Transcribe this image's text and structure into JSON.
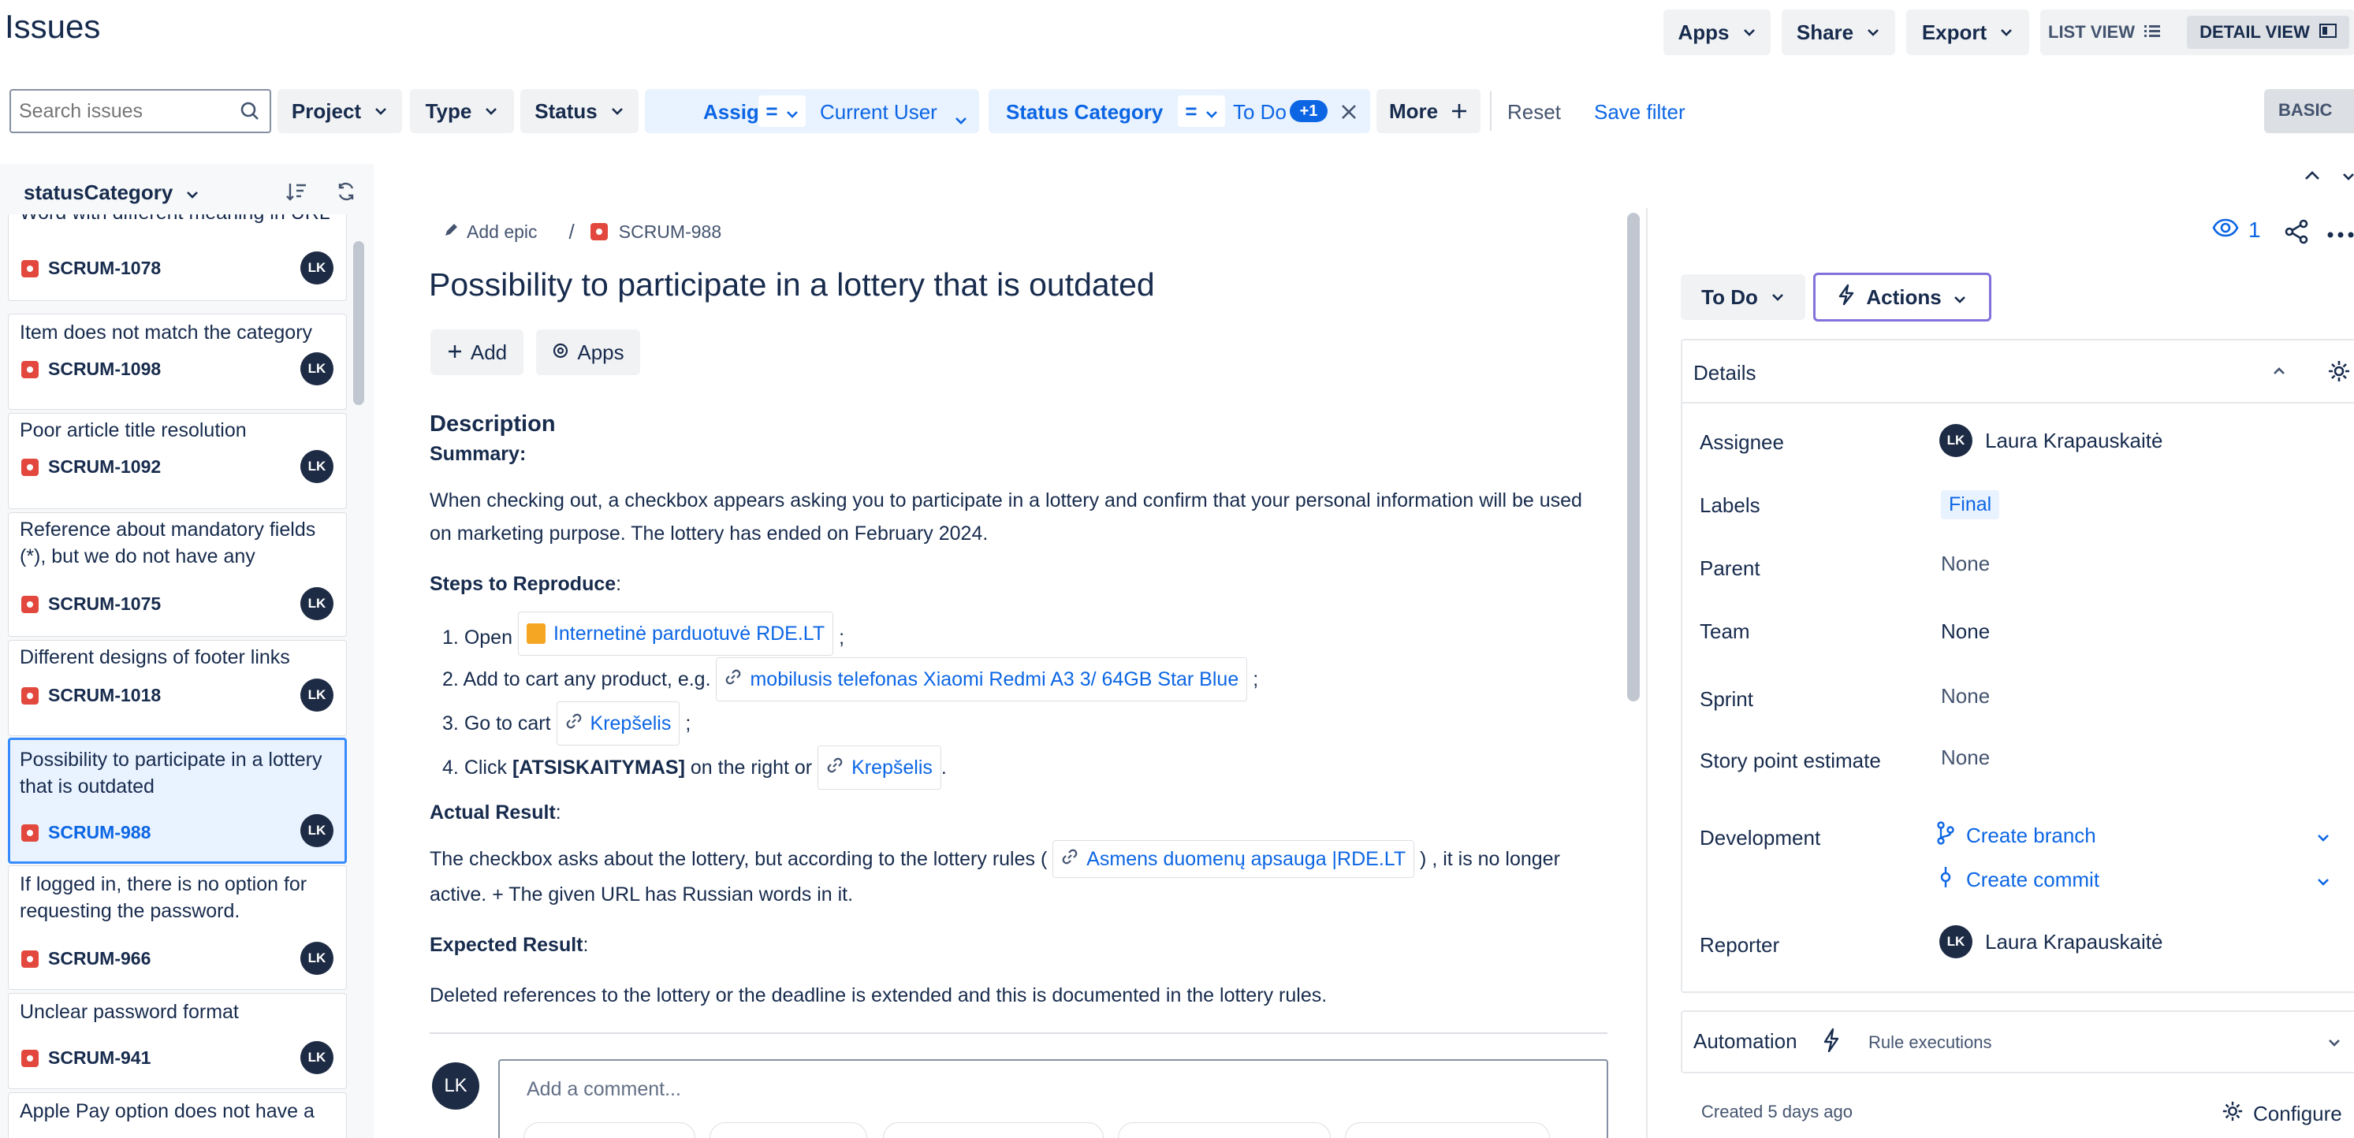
{
  "header": {
    "title": "Issues",
    "apps_label": "Apps",
    "share_label": "Share",
    "export_label": "Export",
    "list_view_label": "LIST VIEW",
    "detail_view_label": "DETAIL VIEW"
  },
  "filters": {
    "search_placeholder": "Search issues",
    "project": "Project",
    "type": "Type",
    "status": "Status",
    "assignee_label": "Assignee",
    "assignee_op": "=",
    "assignee_value": "Current User",
    "status_cat_label": "Status Category",
    "status_cat_op": "=",
    "status_cat_value": "To Do",
    "status_cat_badge": "+1",
    "more": "More",
    "reset": "Reset",
    "save": "Save filter",
    "basic": "BASIC"
  },
  "list": {
    "group_label": "statusCategory",
    "items": [
      {
        "title": "Word with different meaning in URL",
        "key": "SCRUM-1078",
        "avatar": "LK"
      },
      {
        "title": "Item does not match the category",
        "key": "SCRUM-1098",
        "avatar": "LK"
      },
      {
        "title": "Poor article title resolution",
        "key": "SCRUM-1092",
        "avatar": "LK"
      },
      {
        "title": "Reference about mandatory fields (*), but we do not have any",
        "key": "SCRUM-1075",
        "avatar": "LK"
      },
      {
        "title": "Different designs of footer links",
        "key": "SCRUM-1018",
        "avatar": "LK"
      },
      {
        "title": "Possibility to participate in a lottery that is outdated",
        "key": "SCRUM-988",
        "avatar": "LK"
      },
      {
        "title": "If logged in, there is no option for requesting the password.",
        "key": "SCRUM-966",
        "avatar": "LK"
      },
      {
        "title": "Unclear password format",
        "key": "SCRUM-941",
        "avatar": "LK"
      },
      {
        "title": "Apple Pay option does not have a",
        "key": "",
        "avatar": ""
      }
    ]
  },
  "issue": {
    "add_epic": "Add epic",
    "separator": "/",
    "key": "SCRUM-988",
    "title": "Possibility to participate in a lottery that is outdated",
    "add_label": "Add",
    "apps_label": "Apps",
    "description_heading": "Description",
    "summary_heading": "Summary:",
    "summary_text": "When checking out, a checkbox appears asking you to participate in a lottery and confirm that your personal information will be used on marketing purpose. The lottery has ended on February 2024.",
    "steps_heading": "Steps to Reproduce",
    "steps": {
      "s1_num": "1.",
      "s1_pre": "Open",
      "s1_link": "Internetinė parduotuvė RDE.LT",
      "s1_post": ";",
      "s2_num": "2.",
      "s2_pre": "Add to cart any product, e.g.",
      "s2_link": "mobilusis telefonas Xiaomi Redmi A3 3/ 64GB Star Blue",
      "s2_post": ";",
      "s3_num": "3.",
      "s3_pre": "Go to cart",
      "s3_link": "Krepšelis",
      "s3_post": ";",
      "s4_num": "4.",
      "s4_pre": "Click",
      "s4_bold": "[ATSISKAITYMAS]",
      "s4_mid": "on the right or",
      "s4_link": "Krepšelis",
      "s4_post": "."
    },
    "actual_heading": "Actual Result",
    "actual_pre": "The checkbox asks about the lottery, but according to the lottery rules (",
    "actual_link": "Asmens duomenų apsauga |RDE.LT",
    "actual_post": ") , it is no longer active. + The given URL has Russian words in it.",
    "expected_heading": "Expected Result",
    "expected_text": "Deleted references to the lottery or the deadline is extended and this is documented in the lottery rules.",
    "comment_avatar": "LK",
    "comment_placeholder": "Add a comment..."
  },
  "sidebar": {
    "watch_count": "1",
    "status_label": "To Do",
    "actions_label": "Actions",
    "details_heading": "Details",
    "assignee_label": "Assignee",
    "assignee_value": "Laura Krapauskaitė",
    "assignee_avatar": "LK",
    "labels_label": "Labels",
    "labels_value": "Final",
    "parent_label": "Parent",
    "parent_value": "None",
    "team_label": "Team",
    "team_value": "None",
    "sprint_label": "Sprint",
    "sprint_value": "None",
    "story_label": "Story point estimate",
    "story_value": "None",
    "development_label": "Development",
    "create_branch": "Create branch",
    "create_commit": "Create commit",
    "reporter_label": "Reporter",
    "reporter_value": "Laura Krapauskaitė",
    "reporter_avatar": "LK",
    "automation_label": "Automation",
    "rule_executions": "Rule executions",
    "created": "Created 5 days ago",
    "configure": "Configure"
  },
  "colors": {
    "accent": "#0c66e4",
    "bug": "#e2483d",
    "avatar": "#1d2b44",
    "selected_bg": "#e9f2ff"
  }
}
